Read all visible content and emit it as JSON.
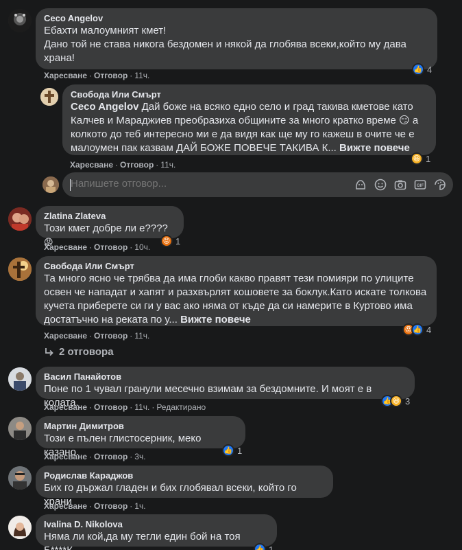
{
  "actions": {
    "like": "Харесване",
    "reply": "Отговор",
    "sep": "·"
  },
  "comments": [
    {
      "author": "Ceco Angelov",
      "text_line1": "Ебахти малоумният кмет!",
      "text_rest": "Дано той не става никога бездомен и някой да глобява всеки,който му дава храна!",
      "time": "11ч.",
      "reaction_count": "4",
      "reaction_icons": [
        "like-icon"
      ]
    },
    {
      "author": "Свобода Или Смърт",
      "mention": "Ceco Angelov",
      "text": " Дай боже на всяко едно село и град такива кметове като Калчев и Мараджиев преобразиха общините за много кратко време 😏 а колкото до теб интересно ми е да видя как ще му го кажеш в очите че е малоумен пак казвам ДАЙ БОЖЕ ПОВЕЧЕ ТАКИВА К...",
      "see_more": "Вижте повече",
      "time": "11ч.",
      "reaction_count": "1",
      "reaction_icons": [
        "haha-icon"
      ]
    },
    {
      "author": "Zlatina Zlateva",
      "text": "Този кмет добре ли е????",
      "emoji": "😡",
      "time": "10ч.",
      "reaction_count": "1",
      "reaction_icons": [
        "angry-icon"
      ]
    },
    {
      "author": "Свобода Или Смърт",
      "text": "Та много ясно че трябва да има глоби какво правят тези помияри по улиците освен че нападат и хапят и разхвърлят кошовете за боклук.Като искате толкова кучета приберете си ги у вас ако няма от къде да си намерите в Куртово има достатъчно на реката по у...",
      "see_more": "Вижте повече",
      "time": "11ч.",
      "reaction_count": "4",
      "reaction_icons": [
        "angry-icon",
        "like-icon"
      ]
    },
    {
      "author": "Васил Панайотов",
      "text": "Поне по 1 чувал гранули месечно взимам за бездомните. И моят е в колата.",
      "time": "11ч.",
      "edited": "Редактирано",
      "reaction_count": "3",
      "reaction_icons": [
        "like-icon",
        "haha-icon"
      ]
    },
    {
      "author": "Мартин Димитров",
      "text": "Този е пълен глистосерник, меко казано.",
      "time": "3ч.",
      "reaction_count": "1",
      "reaction_icons": [
        "like-icon"
      ]
    },
    {
      "author": "Родислав Караджов",
      "text": "Бих го държал гладен и бих глобявал всеки, който го храни",
      "time": "1ч."
    },
    {
      "author": "Ivalina D. Nikolova",
      "text": "Няма ли кой,да му тегли един бой на тоя Б****К",
      "reaction_count": "1",
      "reaction_icons": [
        "like-icon"
      ]
    }
  ],
  "reply_input": {
    "placeholder": "Напишете отговор..."
  },
  "replies_toggle": {
    "label": "2 отговора"
  }
}
